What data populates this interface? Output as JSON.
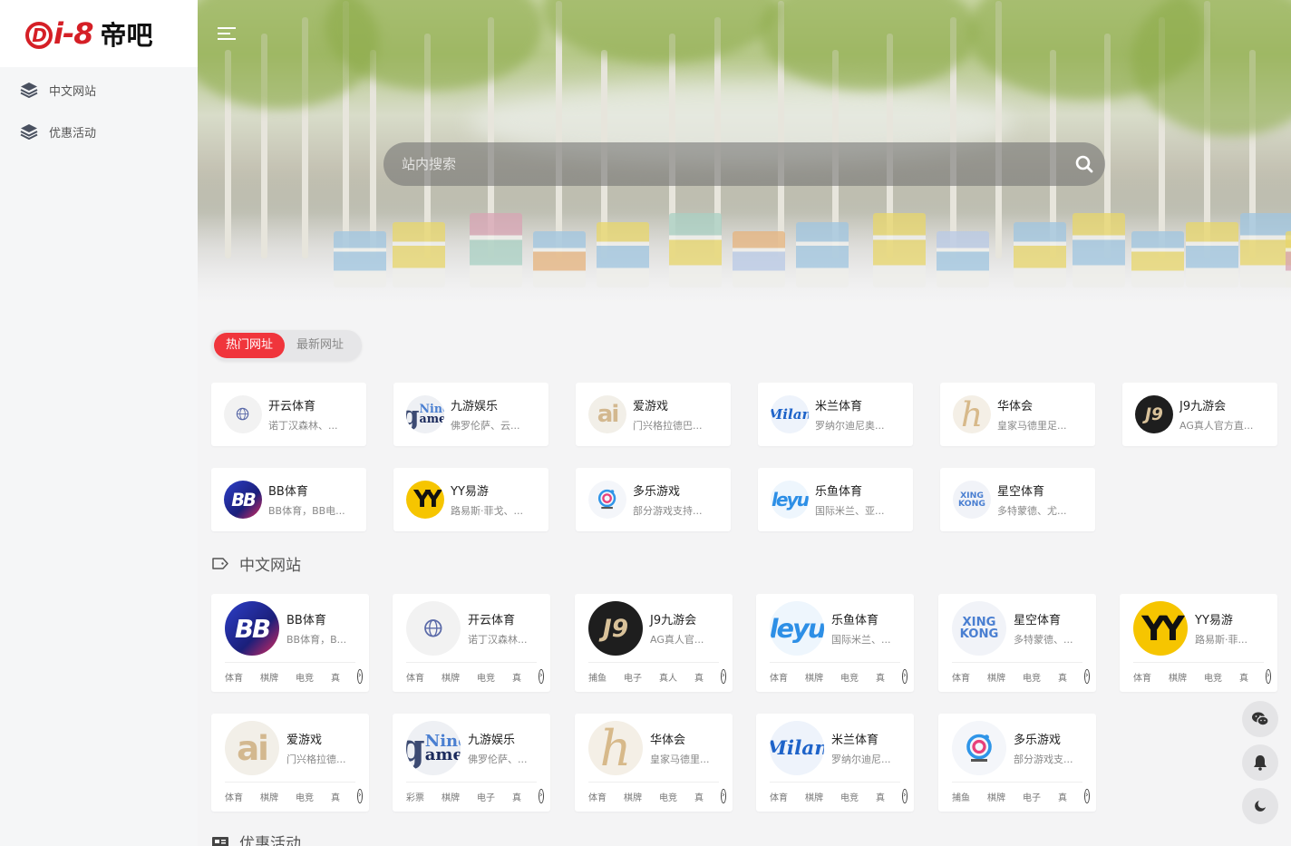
{
  "brand": {
    "mark": "i-8",
    "mark_circle": "D",
    "cn": "帝吧"
  },
  "sidebar": {
    "items": [
      {
        "label": "中文网站"
      },
      {
        "label": "优惠活动"
      }
    ]
  },
  "search": {
    "placeholder": "站内搜索"
  },
  "tabs": [
    {
      "label": "热门网址",
      "active": true
    },
    {
      "label": "最新网址",
      "active": false
    }
  ],
  "hot": [
    {
      "title": "开云体育",
      "desc": "诺丁汉森林、...",
      "logo": "globe"
    },
    {
      "title": "九游娱乐",
      "desc": "佛罗伦萨、云...",
      "logo": "ninegame"
    },
    {
      "title": "爱游戏",
      "desc": "门兴格拉德巴...",
      "logo": "ai"
    },
    {
      "title": "米兰体育",
      "desc": "罗纳尔迪尼奥...",
      "logo": "milan"
    },
    {
      "title": "华体会",
      "desc": "皇家马德里足...",
      "logo": "h"
    },
    {
      "title": "J9九游会",
      "desc": "AG真人官方直...",
      "logo": "j9"
    },
    {
      "title": "BB体育",
      "desc": "BB体育，BB电...",
      "logo": "bb"
    },
    {
      "title": "YY易游",
      "desc": "路易斯·菲戈、...",
      "logo": "yy"
    },
    {
      "title": "多乐游戏",
      "desc": "部分游戏支持...",
      "logo": "duole"
    },
    {
      "title": "乐鱼体育",
      "desc": "国际米兰、亚...",
      "logo": "leyu"
    },
    {
      "title": "星空体育",
      "desc": "多特蒙德、尤...",
      "logo": "xingkong"
    }
  ],
  "section_cn": {
    "title": "中文网站"
  },
  "sites": [
    {
      "title": "BB体育",
      "desc": "BB体育，B...",
      "logo": "bb",
      "tags": [
        "体育",
        "棋牌",
        "电竞",
        "真"
      ]
    },
    {
      "title": "开云体育",
      "desc": "诺丁汉森林...",
      "logo": "globe",
      "tags": [
        "体育",
        "棋牌",
        "电竞",
        "真"
      ]
    },
    {
      "title": "J9九游会",
      "desc": "AG真人官...",
      "logo": "j9",
      "tags": [
        "捕鱼",
        "电子",
        "真人",
        "真"
      ]
    },
    {
      "title": "乐鱼体育",
      "desc": "国际米兰、...",
      "logo": "leyu",
      "tags": [
        "体育",
        "棋牌",
        "电竞",
        "真"
      ]
    },
    {
      "title": "星空体育",
      "desc": "多特蒙德、...",
      "logo": "xingkong",
      "tags": [
        "体育",
        "棋牌",
        "电竞",
        "真"
      ]
    },
    {
      "title": "YY易游",
      "desc": "路易斯·菲...",
      "logo": "yy",
      "tags": [
        "体育",
        "棋牌",
        "电竞",
        "真"
      ]
    },
    {
      "title": "爱游戏",
      "desc": "门兴格拉德...",
      "logo": "ai",
      "tags": [
        "体育",
        "棋牌",
        "电竞",
        "真"
      ]
    },
    {
      "title": "九游娱乐",
      "desc": "佛罗伦萨、...",
      "logo": "ninegame",
      "tags": [
        "彩票",
        "棋牌",
        "电子",
        "真"
      ]
    },
    {
      "title": "华体会",
      "desc": "皇家马德里...",
      "logo": "h",
      "tags": [
        "体育",
        "棋牌",
        "电竞",
        "真"
      ]
    },
    {
      "title": "米兰体育",
      "desc": "罗纳尔迪尼...",
      "logo": "milan",
      "tags": [
        "体育",
        "棋牌",
        "电竞",
        "真"
      ]
    },
    {
      "title": "多乐游戏",
      "desc": "部分游戏支...",
      "logo": "duole",
      "tags": [
        "捕鱼",
        "棋牌",
        "电子",
        "真"
      ]
    }
  ],
  "section_promo": {
    "title": "优惠活动"
  },
  "float_buttons": [
    {
      "icon": "wechat-icon"
    },
    {
      "icon": "bell-icon"
    },
    {
      "icon": "moon-icon"
    }
  ],
  "colors": {
    "accent": "#f0353c",
    "brand": "#d51f26"
  }
}
